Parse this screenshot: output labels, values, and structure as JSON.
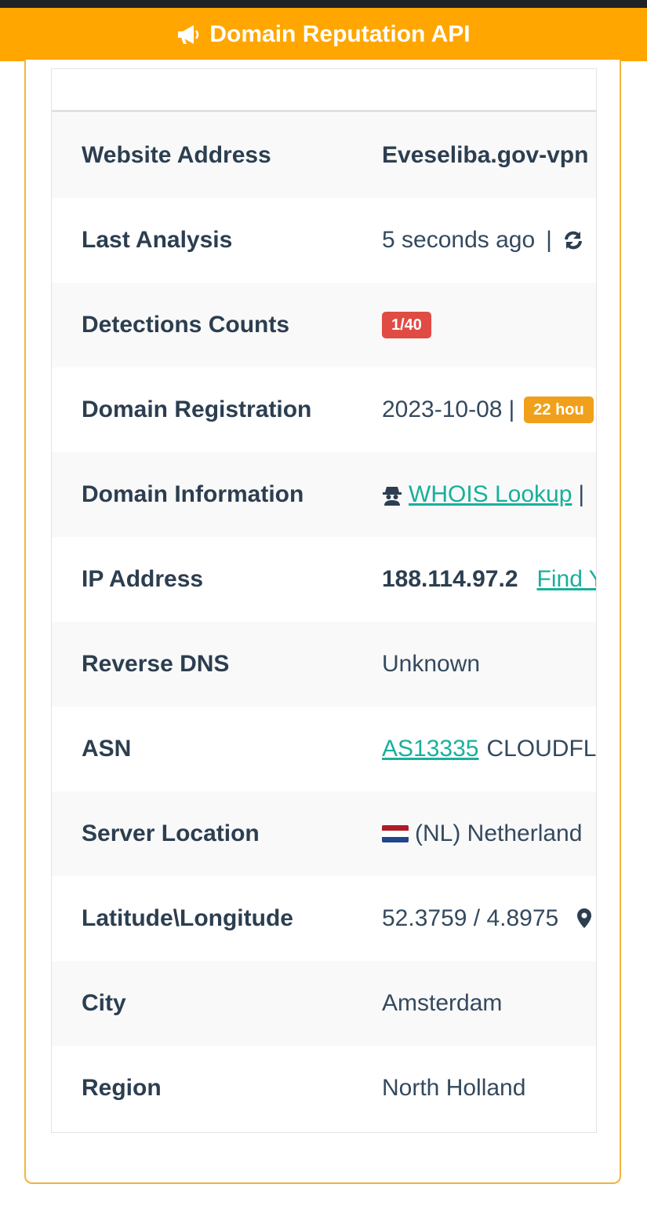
{
  "header": {
    "title": "Domain Reputation API"
  },
  "rows": {
    "website": {
      "label": "Website Address",
      "value": "Eveseliba.gov-vpn"
    },
    "last_analysis": {
      "label": "Last Analysis",
      "value": "5 seconds ago",
      "separator": "|"
    },
    "detections": {
      "label": "Detections Counts",
      "badge": "1/40"
    },
    "registration": {
      "label": "Domain Registration",
      "date": "2023-10-08",
      "separator": "|",
      "badge": "22 hou"
    },
    "domain_info": {
      "label": "Domain Information",
      "link": "WHOIS Lookup",
      "separator": "|"
    },
    "ip": {
      "label": "IP Address",
      "value": "188.114.97.2",
      "link": "Find Y"
    },
    "rdns": {
      "label": "Reverse DNS",
      "value": "Unknown"
    },
    "asn": {
      "label": "ASN",
      "link": "AS13335",
      "value": "CLOUDFL"
    },
    "location": {
      "label": "Server Location",
      "value": "(NL) Netherland"
    },
    "latlong": {
      "label": "Latitude\\Longitude",
      "value": "52.3759 / 4.8975"
    },
    "city": {
      "label": "City",
      "value": "Amsterdam"
    },
    "region": {
      "label": "Region",
      "value": "North Holland"
    }
  },
  "colors": {
    "header_bg": "#ffa600",
    "link": "#18b09b",
    "danger_badge": "#e04b44",
    "warning_badge": "#f0a01a"
  },
  "icons": {
    "header": "megaphone-icon",
    "refresh": "refresh-icon",
    "whois": "spy-icon",
    "flag": "netherlands-flag-icon",
    "map": "map-marker-icon"
  }
}
